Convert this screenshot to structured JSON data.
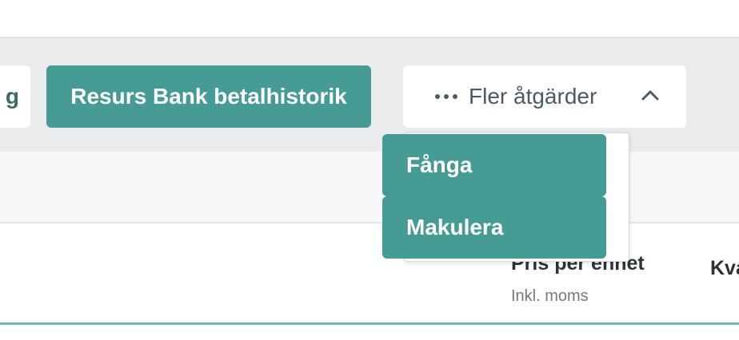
{
  "toolbar": {
    "partial_button_label": "g",
    "resurs_button_label": "Resurs Bank betalhistorik",
    "more_actions_label": "Fler åtgärder",
    "more_actions_icon": "ellipsis-icon",
    "chevron_icon": "chevron-up-icon"
  },
  "dropdown": {
    "items": [
      {
        "label": "Fånga"
      },
      {
        "label": "Makulera"
      }
    ]
  },
  "table_header": {
    "price_label": "Pris per enhet",
    "price_sublabel": "Inkl. moms",
    "quantity_label": "Kva"
  },
  "colors": {
    "accent": "#469b95",
    "toolbar_bg": "#eaebec",
    "accent_line": "#6fb6bb"
  }
}
